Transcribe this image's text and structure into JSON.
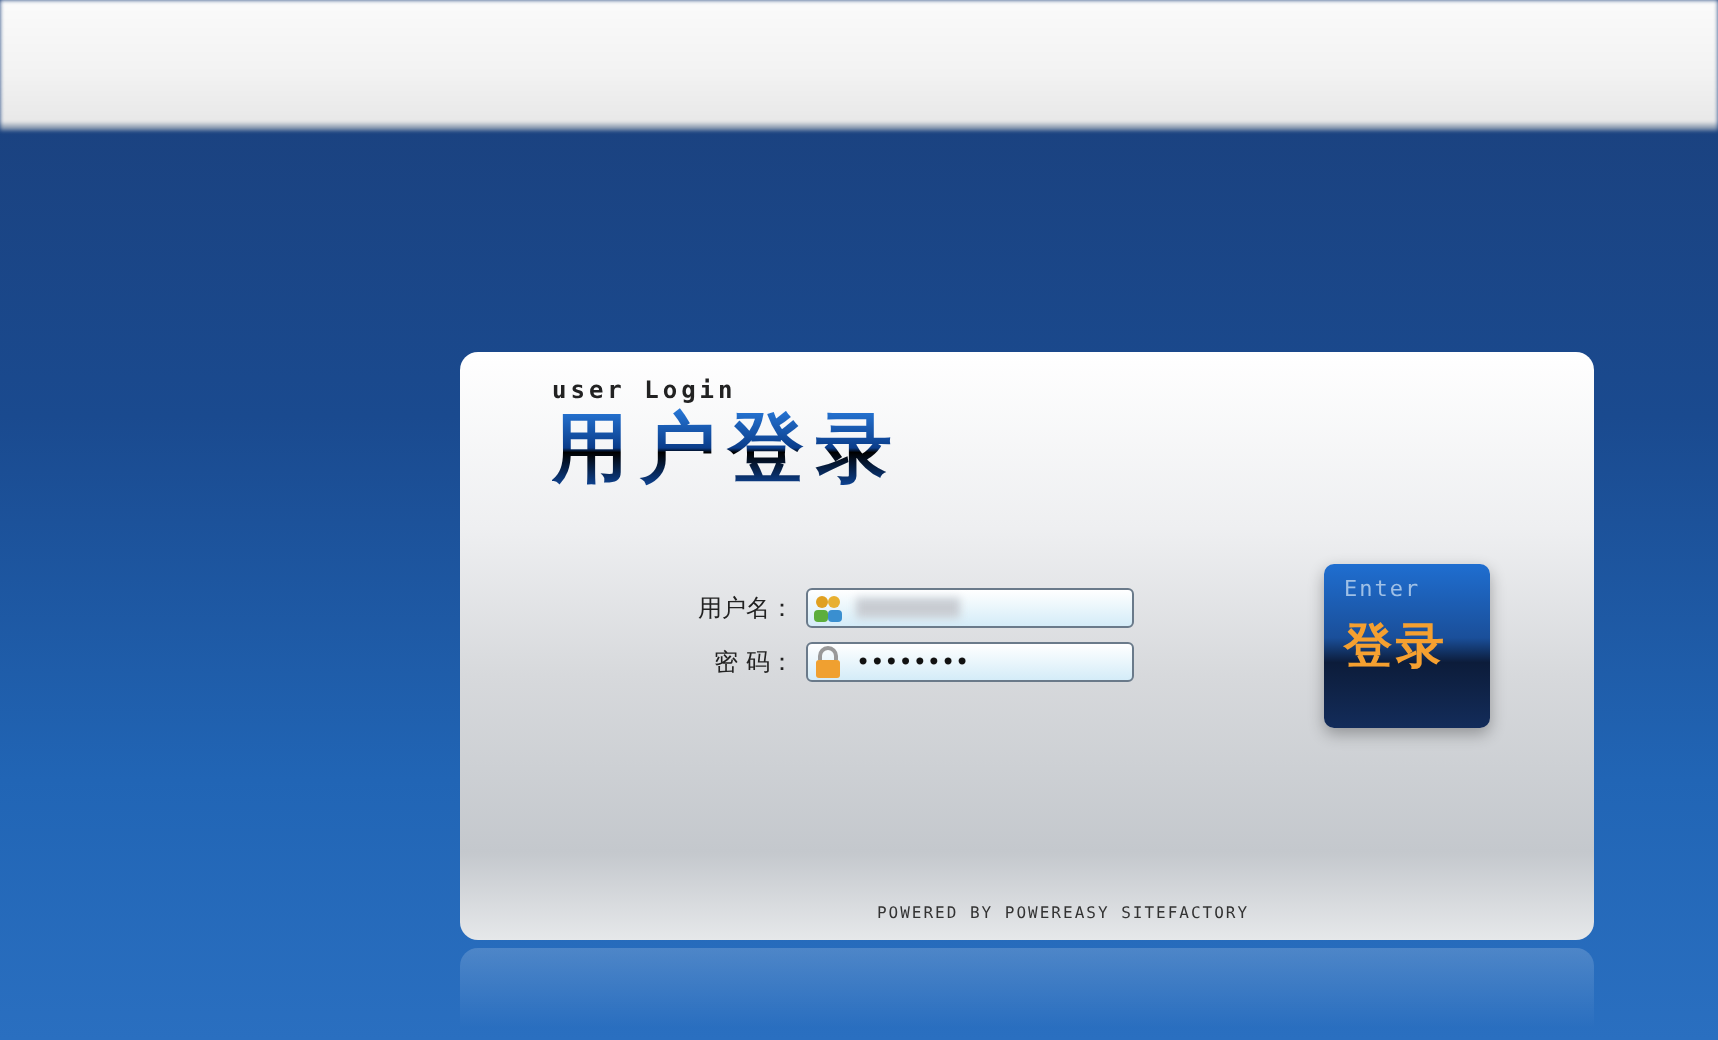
{
  "login_card": {
    "subtitle": "user Login",
    "title": "用户登录",
    "fields": [
      {
        "kind": "username",
        "label": "用户名："
      },
      {
        "kind": "password",
        "label": "密 码：",
        "value": "••••••••"
      }
    ],
    "submit": {
      "caption": "Enter",
      "label": "登录"
    },
    "footer": "POWERED BY POWEREASY SITEFACTORY"
  }
}
